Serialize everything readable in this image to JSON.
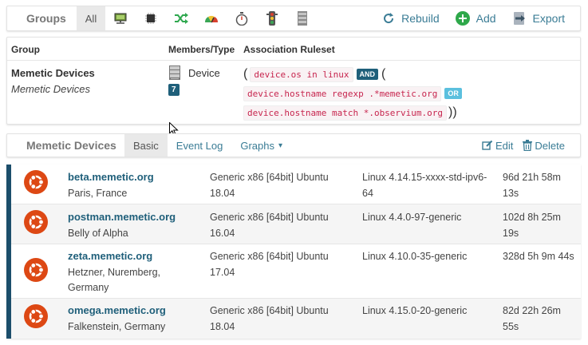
{
  "topbar": {
    "title": "Groups",
    "all_label": "All",
    "icons": [
      "network-icon",
      "chip-icon",
      "shuffle-icon",
      "gauge-icon",
      "stopwatch-icon",
      "traffic-light-icon",
      "storage-icon"
    ],
    "rebuild_label": "Rebuild",
    "add_label": "Add",
    "export_label": "Export"
  },
  "group": {
    "headers": {
      "group": "Group",
      "members": "Members/Type",
      "ruleset": "Association Ruleset"
    },
    "name": "Memetic Devices",
    "description": "Memetic Devices",
    "type": "Device",
    "count": "7",
    "rules": {
      "open": "(",
      "rule1": "device.os in linux",
      "and_label": "AND",
      "open2": "(",
      "rule2": "device.hostname regexp .*memetic.org",
      "or_label": "OR",
      "rule3": "device.hostname match *.observium.org",
      "close": "))"
    }
  },
  "navbar": {
    "brand": "Memetic Devices",
    "tabs": [
      "Basic",
      "Event Log",
      "Graphs"
    ],
    "graphs_caret": "▾",
    "edit_label": "Edit",
    "delete_label": "Delete"
  },
  "devices": [
    {
      "hostname": "beta.memetic.org",
      "location": "Paris, France",
      "hardware": "Generic x86 [64bit] Ubuntu 18.04",
      "os": "Linux 4.14.15-xxxx-std-ipv6-64",
      "uptime": "96d 21h 58m 13s"
    },
    {
      "hostname": "postman.memetic.org",
      "location": "Belly of Alpha",
      "hardware": "Generic x86 [64bit] Ubuntu 16.04",
      "os": "Linux 4.4.0-97-generic",
      "uptime": "102d 8h 25m 19s"
    },
    {
      "hostname": "zeta.memetic.org",
      "location": "Hetzner, Nuremberg, Germany",
      "hardware": "Generic x86 [64bit] Ubuntu 17.04",
      "os": "Linux 4.10.0-35-generic",
      "uptime": "328d 5h 9m 44s"
    },
    {
      "hostname": "omega.memetic.org",
      "location": "Falkenstein, Germany",
      "hardware": "Generic x86 [64bit] Ubuntu 18.04",
      "os": "Linux 4.15.0-20-generic",
      "uptime": "82d 22h 26m 55s"
    }
  ],
  "colors": {
    "accent": "#1f5f7a",
    "link": "#3a7c95",
    "ubuntu": "#dd4814",
    "add_green": "#2ea84a"
  }
}
